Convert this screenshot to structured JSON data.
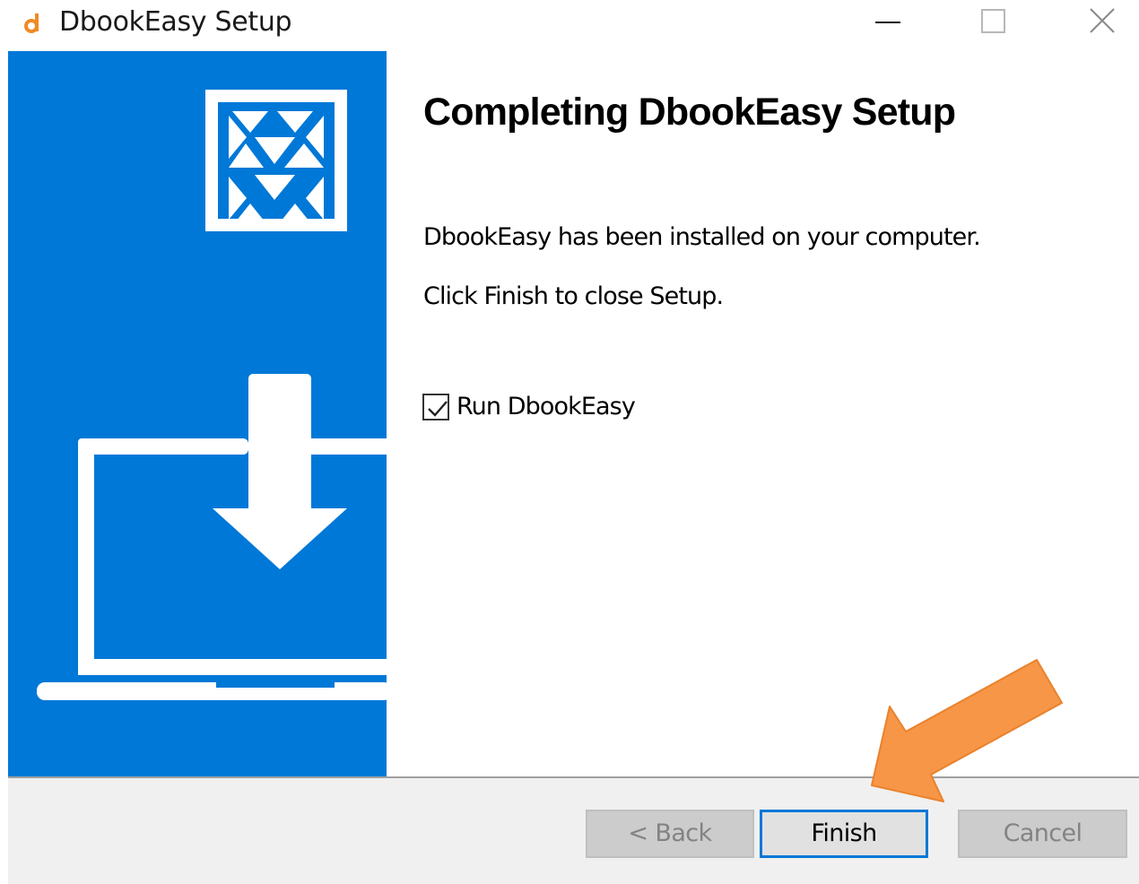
{
  "window": {
    "title": "DbookEasy Setup",
    "app_icon": "dbookeasy-logo-icon",
    "controls": {
      "minimize_icon": "minimize-icon",
      "maximize_icon": "maximize-icon",
      "close_icon": "close-icon"
    }
  },
  "side_panel": {
    "background_color": "#0078d7",
    "logo_icon": "triangle-grid-logo-icon",
    "illustration_icon": "laptop-download-icon"
  },
  "content": {
    "heading": "Completing DbookEasy Setup",
    "message": "DbookEasy has been installed on your computer.",
    "instruction": "Click Finish to close Setup.",
    "run_checkbox": {
      "label": "Run DbookEasy",
      "checked": true
    }
  },
  "buttons": {
    "back_label": "< Back",
    "finish_label": "Finish",
    "cancel_label": "Cancel",
    "back_enabled": false,
    "cancel_enabled": false
  },
  "annotation": {
    "arrow_color": "#f79646",
    "arrow_icon": "pointer-arrow-icon"
  }
}
